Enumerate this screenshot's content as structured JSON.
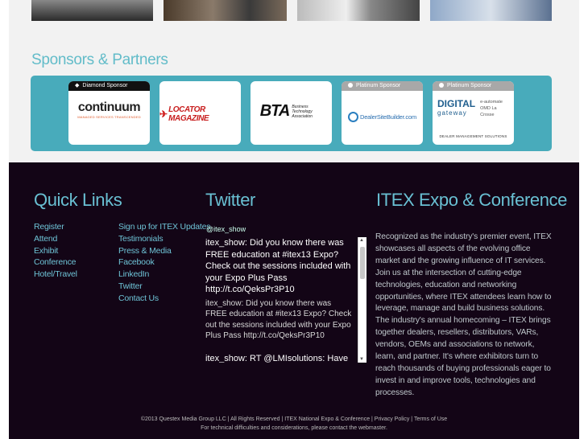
{
  "sponsors": {
    "title": "Sponsors & Partners",
    "cards": [
      {
        "tag": "Diamond Sponsor",
        "logo_main": "continuum",
        "logo_sub": "MANAGED SERVICES TRANSCENDED"
      },
      {
        "tag": "",
        "logo_main": "LOCATOR MAGAZINE"
      },
      {
        "tag": "",
        "logo_main": "BTA",
        "logo_sub": "Business Technology Association"
      },
      {
        "tag": "Platinum Sponsor",
        "logo_main": "DealerSiteBuilder.com"
      },
      {
        "tag": "Platinum Sponsor",
        "logo_main": "DIGITAL",
        "logo_sub": "gateway",
        "logo_side": "e-automate OMD La Crosse",
        "logo_foot": "DEALER MANAGEMENT SOLUTIONS"
      }
    ]
  },
  "quick_links": {
    "title": "Quick Links",
    "col1": [
      "Register",
      "Attend",
      "Exhibit",
      "Conference",
      "Hotel/Travel"
    ],
    "col2": [
      "Sign up for ITEX Updates",
      "Testimonials",
      "Press & Media",
      "Facebook",
      "LinkedIn",
      "Twitter",
      "Contact Us"
    ]
  },
  "twitter": {
    "title": "Twitter",
    "handle": "@itex_show",
    "tweet1_strong": "itex_show: Did you know there was FREE education at #itex13 Expo? Check out the sessions included with your Expo Plus Pass http://t.co/QeksPr3P10",
    "tweet1": "itex_show: Did you know there was FREE education at #itex13 Expo? Check out the sessions included with your Expo Plus Pass http://t.co/QeksPr3P10",
    "tweet2_strong": "itex_show: RT @LMIsolutions: Have you"
  },
  "about": {
    "title": "ITEX Expo & Conference",
    "body": "Recognized as the industry's premier event, ITEX showcases all aspects of the evolving office market and the growing influence of IT services. Join us at the intersection of cutting-edge technologies, education and networking opportunities, where ITEX attendees learn how to leverage, manage and build business solutions. The industry's annual homecoming – ITEX brings together dealers, resellers, distributors, VARs, vendors, OEMs and associations to network, learn, and partner. It's where exhibitors turn to reach thousands of buying professionals eager to invest in and improve tools, technologies and processes."
  },
  "footer": {
    "copyright": "©2013 Questex Media Group LLC | All Rights Reserved | ITEX National Expo & Conference | Privacy Policy | Terms of Use",
    "note": "For technical difficulties and considerations, please contact the webmaster."
  },
  "colors": {
    "accent": "#48abbb",
    "title": "#69c0d3",
    "footer_bg": "#130516"
  }
}
